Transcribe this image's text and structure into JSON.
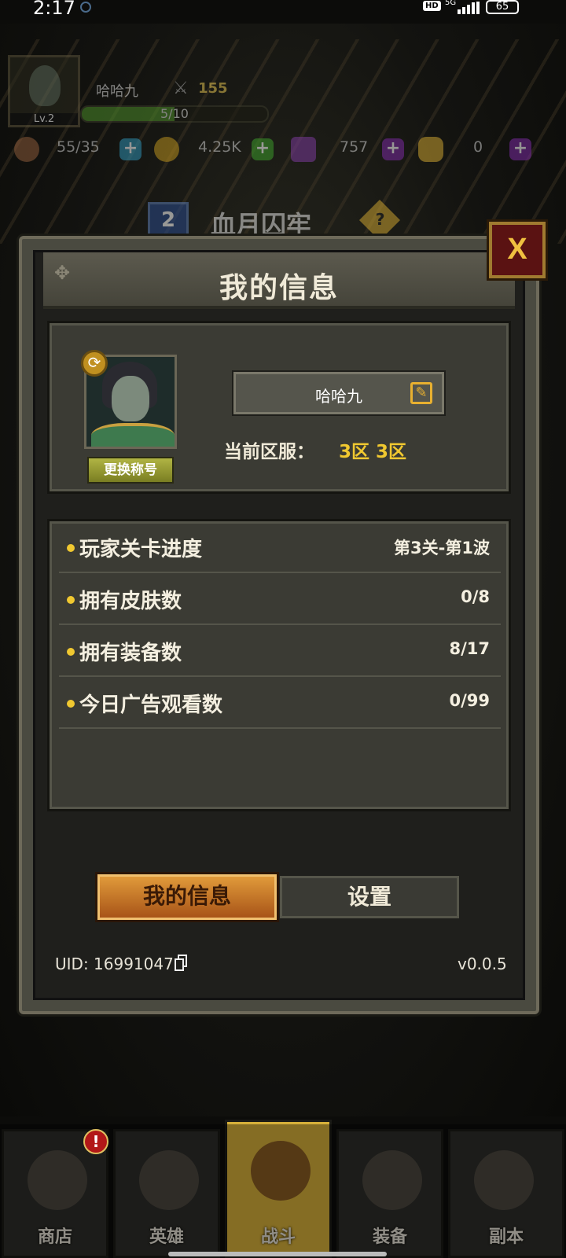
{
  "status_bar": {
    "time": "2:17",
    "hd": "HD",
    "network": "5G",
    "battery": "65"
  },
  "hud": {
    "level": "Lv.2",
    "player_name": "哈哈九",
    "power": "155",
    "exp": "5/10",
    "exp_progress": 0.5,
    "resources": [
      {
        "icon": "meat-icon",
        "value": "55/35"
      },
      {
        "icon": "gold-coin-icon",
        "value": "4.25K"
      },
      {
        "icon": "diamond-icon",
        "value": "757"
      },
      {
        "icon": "crystal-icon",
        "value": "0"
      }
    ],
    "stage_number": "2",
    "stage_name": "血月囚牢",
    "help": "?"
  },
  "dialog": {
    "title": "我的信息",
    "close_label": "X",
    "profile": {
      "change_title_label": "更换称号",
      "name": "哈哈九",
      "server_label": "当前区服：",
      "server_value": "3区 3区"
    },
    "stats": [
      {
        "label": "玩家关卡进度",
        "value": "第3关-第1波"
      },
      {
        "label": "拥有皮肤数",
        "value": "0/8"
      },
      {
        "label": "拥有装备数",
        "value": "8/17"
      },
      {
        "label": "今日广告观看数",
        "value": "0/99"
      }
    ],
    "tabs": {
      "active": "我的信息",
      "inactive": "设置"
    },
    "uid": "UID: 16991047",
    "version": "v0.0.5"
  },
  "bottom_nav": {
    "items": [
      {
        "label": "商店",
        "icon": "shop-bag-icon"
      },
      {
        "label": "英雄",
        "icon": "hero-helmet-icon"
      },
      {
        "label": "战斗",
        "icon": "crossed-swords-icon"
      },
      {
        "label": "装备",
        "icon": "boots-icon"
      },
      {
        "label": "副本",
        "icon": "scroll-icon"
      }
    ],
    "active_index": 2,
    "notification": "!"
  }
}
